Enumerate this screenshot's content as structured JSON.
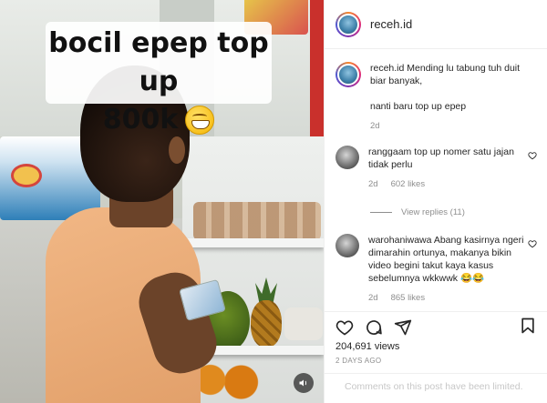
{
  "media": {
    "caption_line1": "bocil epep top up",
    "caption_line2": "800k"
  },
  "header": {
    "username": "receh.id"
  },
  "comments": [
    {
      "username": "receh.id",
      "text_part1": "Mending lu tabung tuh duit biar banyak,",
      "text_part2": "nanti baru top up epep",
      "time": "2d"
    },
    {
      "username": "ranggaam",
      "text": "top up nomer satu jajan tidak perlu",
      "time": "2d",
      "likes": "602 likes",
      "view_replies": "View replies (11)"
    },
    {
      "username": "warohaniwawa",
      "text": "Abang kasirnya ngeri dimarahin ortunya, makanya bikin video begini takut kaya kasus sebelumnya wkkwwk 😂😂",
      "time": "2d",
      "likes": "865 likes"
    }
  ],
  "stats": {
    "views": "204,691 views",
    "posted": "2 DAYS AGO"
  },
  "footer": {
    "limited_text": "Comments on this post have been limited."
  },
  "icons": {
    "like": "heart-icon",
    "comment": "comment-icon",
    "share": "share-icon",
    "save": "bookmark-icon",
    "volume": "speaker-icon"
  }
}
